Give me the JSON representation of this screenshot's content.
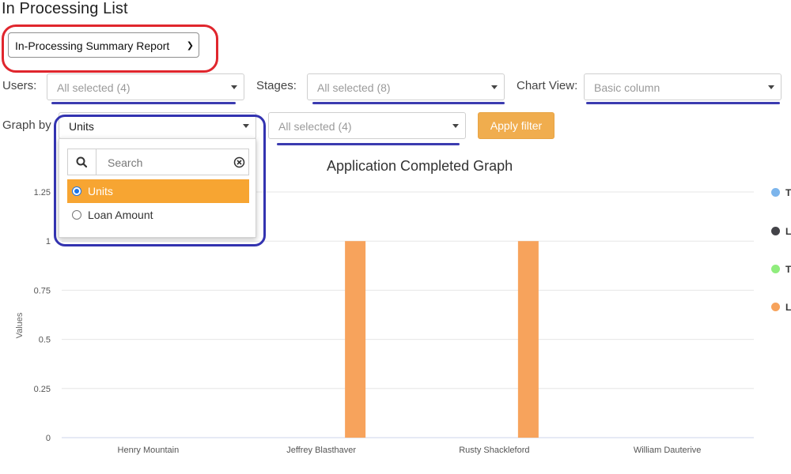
{
  "page": {
    "title": "In Processing List"
  },
  "report": {
    "selected": "In-Processing Summary Report"
  },
  "filters": {
    "users_label": "Users:",
    "users_value": "All selected (4)",
    "stages_label": "Stages:",
    "stages_value": "All selected (8)",
    "chartview_label": "Chart View:",
    "chartview_value": "Basic column",
    "graphby_label": "Graph by",
    "graphby_value": "Units",
    "second_value": "All selected (4)",
    "apply_label": "Apply filter"
  },
  "graph_dropdown": {
    "search_placeholder": "Search",
    "options": [
      {
        "label": "Units",
        "selected": true
      },
      {
        "label": "Loan Amount",
        "selected": false
      }
    ]
  },
  "legend": [
    {
      "label": "T",
      "color": "#7cb5ec"
    },
    {
      "label": "L",
      "color": "#434348"
    },
    {
      "label": "T",
      "color": "#90ed7d"
    },
    {
      "label": "L",
      "color": "#f7a35c"
    }
  ],
  "chart_data": {
    "type": "bar",
    "title": "Application Completed Graph",
    "ylabel": "Values",
    "xlabel": "",
    "ylim": [
      0,
      1.25
    ],
    "yticks": [
      "0",
      "0.25",
      "0.5",
      "0.75",
      "1",
      "1.25"
    ],
    "categories": [
      "Henry Mountain",
      "Jeffrey Blasthaver",
      "Rusty Shackleford",
      "William Dauterive"
    ],
    "series": [
      {
        "values": [
          0,
          1,
          1,
          0
        ],
        "color": "#f7a35c"
      }
    ],
    "grid": true,
    "legend": "right"
  }
}
